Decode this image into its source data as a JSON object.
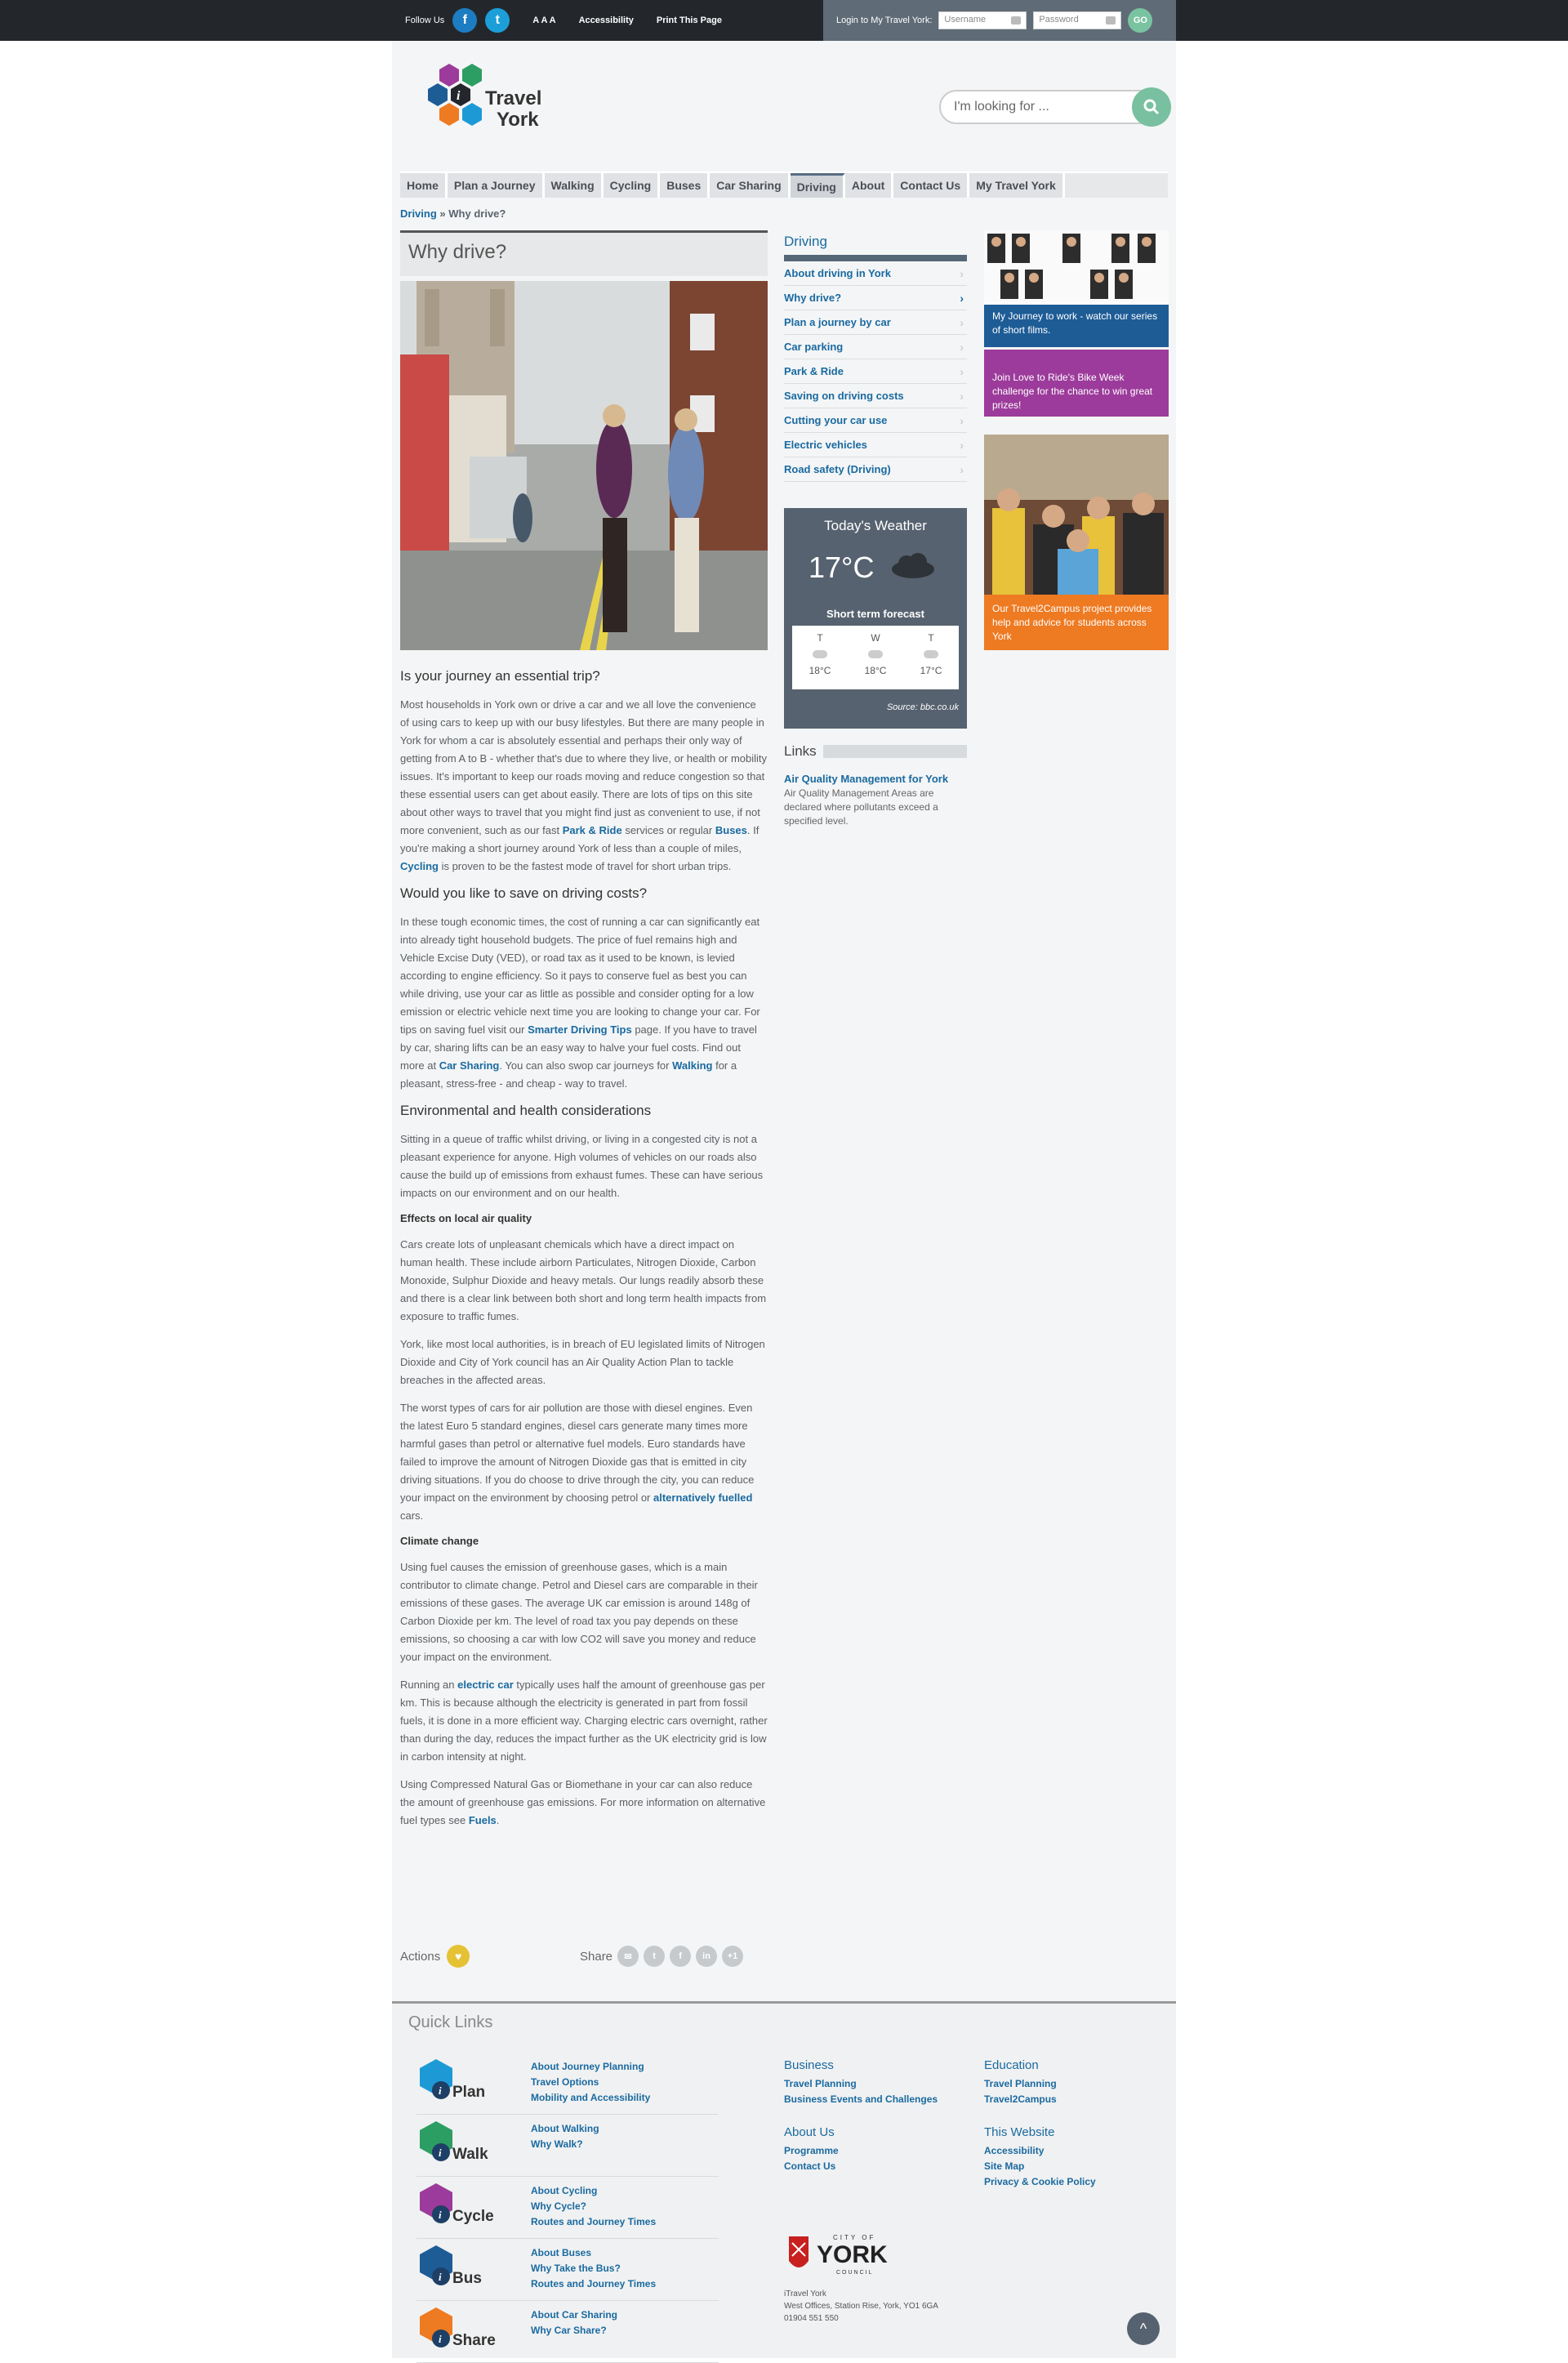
{
  "topbar": {
    "follow": "Follow Us",
    "fb": "f",
    "tw": "t",
    "aaa": "A A A",
    "accessibility": "Accessibility",
    "print": "Print This Page",
    "login_label": "Login to My Travel York:",
    "username_ph": "Username",
    "password_ph": "Password",
    "go": "GO"
  },
  "logo": {
    "text1": "Travel",
    "text2": "York"
  },
  "search": {
    "placeholder": "I'm looking for ..."
  },
  "nav": [
    "Home",
    "Plan a Journey",
    "Walking",
    "Cycling",
    "Buses",
    "Car Sharing",
    "Driving",
    "About",
    "Contact Us",
    "My Travel York"
  ],
  "breadcrumb": {
    "parent": "Driving",
    "sep": "»",
    "current": "Why drive?"
  },
  "page_title": "Why drive?",
  "article": {
    "h1": "Is your journey an essential trip?",
    "p1a": "Most households in York own or drive a car and we all love the convenience of using cars to keep up with our busy lifestyles.  But there are many people in York for whom a car is absolutely essential and perhaps their only way of getting from A to B - whether that's due to where they live, or health or mobility issues. It's important to keep our roads moving and reduce congestion so that these essential users can get about easily. There are lots of tips on this site about other ways to travel that you might find just as convenient to use, if not more convenient, such as our fast ",
    "p1_parkride": "Park & Ride",
    "p1b": " services or regular ",
    "p1_buses": "Buses",
    "p1c": ". If you're making a short journey around York of less than a couple of miles, ",
    "p1_cycling": "Cycling",
    "p1d": " is proven to be the fastest mode of travel for short urban trips.",
    "h2": "Would you like to save on driving costs?",
    "p2a": "In these tough economic times, the cost of running a car can significantly eat into already tight household budgets. The price of fuel remains high and Vehicle Excise Duty (VED), or road tax as it used to be known, is levied according to engine efficiency. So it pays to conserve fuel as best you can while driving, use your car as little as possible and consider opting for a low emission or electric vehicle next time you are looking to change your car. For tips on saving fuel visit our ",
    "p2_smarter": "Smarter Driving Tips",
    "p2b": " page. If you have to travel by car, sharing lifts can be an easy way to halve your fuel costs. Find out more at ",
    "p2_carsharing": "Car Sharing",
    "p2c": ". You can also swop car journeys for ",
    "p2_walking": "Walking",
    "p2d": " for a pleasant, stress-free - and cheap - way to travel.",
    "h3": "Environmental and health considerations",
    "p3": "Sitting in a queue of traffic whilst driving, or living in a congested city is not a pleasant experience for anyone. High volumes of vehicles on our roads also cause the build up of emissions from exhaust fumes. These can have serious impacts on our environment and on our health.",
    "h4": "Effects on local air quality",
    "p4": "Cars create lots of unpleasant chemicals which have a direct impact on human health. These include airborn Particulates, Nitrogen Dioxide, Carbon Monoxide, Sulphur Dioxide and heavy metals. Our lungs readily absorb these and there is a clear link between both short and long term health impacts from exposure to traffic fumes.",
    "p5": "York, like most local authorities, is in breach of EU legislated limits of Nitrogen Dioxide and City of York council has an Air Quality Action Plan to tackle breaches in the affected areas.",
    "p6a": "The worst types of cars for air pollution are those with diesel engines. Even the latest Euro 5 standard engines, diesel cars generate many times more harmful gases than petrol or alternative fuel models. Euro standards have failed to improve the amount of Nitrogen Dioxide gas that is emitted in city driving situations. If you do choose to drive through the city, you can reduce your impact on the environment by choosing petrol or ",
    "p6_alt": "alternatively fuelled",
    "p6b": " cars.",
    "h5": "Climate change",
    "p7": "Using fuel causes the emission of greenhouse gases, which is a main contributor to climate change. Petrol and Diesel cars are comparable in their emissions of these gases. The average UK car emission is around 148g of Carbon Dioxide per km. The level of road tax you pay depends on these emissions, so choosing a car with low CO2 will save you money and reduce your impact on the environment.",
    "p8a": "Running an ",
    "p8_electric": "electric car",
    "p8b": " typically uses half the amount of greenhouse gas per km. This is because although the electricity is generated in part from fossil fuels, it is done in a more efficient way. Charging electric cars overnight, rather than during the day, reduces the impact further as the UK electricity grid is low in carbon intensity at night.",
    "p9a": "Using Compressed Natural Gas or Biomethane in your car can also reduce the amount of greenhouse gas emissions. For more information on alternative fuel types see ",
    "p9_fuels": "Fuels",
    "p9b": "."
  },
  "actions": {
    "label": "Actions",
    "share": "Share",
    "icons": [
      "✉",
      "t",
      "f",
      "in",
      "+1"
    ]
  },
  "sidenav": {
    "title": "Driving",
    "items": [
      "About driving in York",
      "Why drive?",
      "Plan a journey by car",
      "Car parking",
      "Park & Ride",
      "Saving on driving costs",
      "Cutting your car use",
      "Electric vehicles",
      "Road safety (Driving)"
    ]
  },
  "weather": {
    "title": "Today's Weather",
    "temp": "17°C",
    "forecast_title": "Short term forecast",
    "days": [
      {
        "d": "T",
        "t": "18°C"
      },
      {
        "d": "W",
        "t": "18°C"
      },
      {
        "d": "T",
        "t": "17°C"
      }
    ],
    "source": "Source: bbc.co.uk"
  },
  "links": {
    "title": "Links",
    "item": "Air Quality Management for York",
    "desc": "Air Quality Management Areas are declared where pollutants exceed a specified level."
  },
  "promos": [
    {
      "caption": "My Journey to work - watch our series of short films.",
      "color": "#1e5c96"
    },
    {
      "caption": "Join Love to Ride's Bike Week challenge for the chance to win great prizes!",
      "color": "#9c3b9b"
    },
    {
      "caption": "Our Travel2Campus project provides help and advice for students across York",
      "color": "#ee7a22"
    }
  ],
  "footer": {
    "title": "Quick Links",
    "rows": [
      {
        "icon": "Plan",
        "color": "#1d9ad6",
        "links": [
          "About Journey Planning",
          "Travel Options",
          "Mobility and Accessibility"
        ]
      },
      {
        "icon": "Walk",
        "color": "#2c9e63",
        "links": [
          "About Walking",
          "Why Walk?"
        ]
      },
      {
        "icon": "Cycle",
        "color": "#9c3b9b",
        "links": [
          "About Cycling",
          "Why Cycle?",
          "Routes and Journey Times"
        ]
      },
      {
        "icon": "Bus",
        "color": "#1e5c96",
        "links": [
          "About Buses",
          "Why Take the Bus?",
          "Routes and Journey Times"
        ]
      },
      {
        "icon": "Share",
        "color": "#ee7a22",
        "links": [
          "About Car Sharing",
          "Why Car Share?"
        ]
      }
    ],
    "business": {
      "title": "Business",
      "links": [
        "Travel Planning",
        "Business Events and Challenges"
      ]
    },
    "about": {
      "title": "About Us",
      "links": [
        "Programme",
        "Contact Us"
      ]
    },
    "education": {
      "title": "Education",
      "links": [
        "Travel Planning",
        "Travel2Campus"
      ]
    },
    "website": {
      "title": "This Website",
      "links": [
        "Accessibility",
        "Site Map",
        "Privacy & Cookie Policy"
      ]
    },
    "council": {
      "city_of": "CITY OF",
      "york": "YORK",
      "council": "COUNCIL"
    },
    "address": [
      "iTravel York",
      "West Offices, Station Rise, York, YO1 6GA",
      "01904 551 550"
    ],
    "totop": "^"
  }
}
